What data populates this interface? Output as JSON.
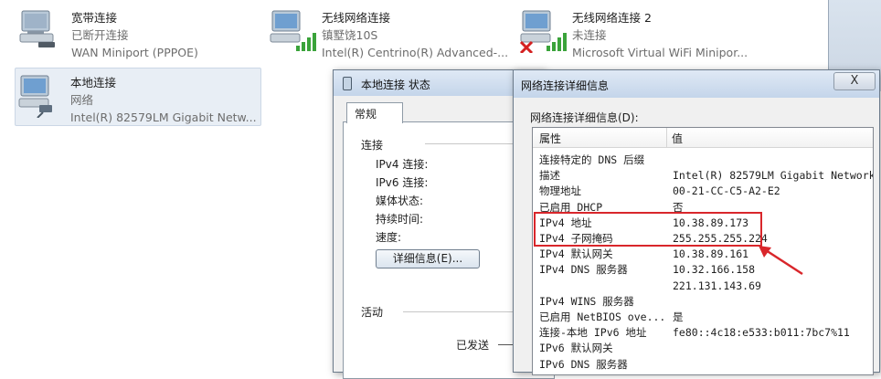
{
  "connections": [
    {
      "name": "宽带连接",
      "status": "已断开连接",
      "device": "WAN Miniport (PPPOE)"
    },
    {
      "name": "无线网络连接",
      "status": "镇墅饶10S",
      "device": "Intel(R) Centrino(R) Advanced-..."
    },
    {
      "name": "无线网络连接 2",
      "status": "未连接",
      "device": "Microsoft Virtual WiFi Minipor..."
    },
    {
      "name": "本地连接",
      "status": "网络",
      "device": "Intel(R) 82579LM Gigabit Netw..."
    }
  ],
  "status_window": {
    "title": "本地连接 状态",
    "tab": "常规",
    "connection_section": "连接",
    "labels": [
      "IPv4 连接:",
      "IPv6 连接:",
      "媒体状态:",
      "持续时间:",
      "速度:"
    ],
    "details_button": "详细信息(E)...",
    "activity_section": "活动",
    "sent_label": "已发送"
  },
  "details_window": {
    "title": "网络连接详细信息",
    "close": "X",
    "caption": "网络连接详细信息(D):",
    "col_property": "属性",
    "col_value": "值",
    "rows": [
      {
        "p": "连接特定的 DNS 后缀",
        "v": ""
      },
      {
        "p": "描述",
        "v": "Intel(R) 82579LM Gigabit Network"
      },
      {
        "p": "物理地址",
        "v": "00-21-CC-C5-A2-E2"
      },
      {
        "p": "已启用 DHCP",
        "v": "否"
      },
      {
        "p": "IPv4 地址",
        "v": "10.38.89.173"
      },
      {
        "p": "IPv4 子网掩码",
        "v": "255.255.255.224"
      },
      {
        "p": "IPv4 默认网关",
        "v": "10.38.89.161"
      },
      {
        "p": "IPv4 DNS 服务器",
        "v": "10.32.166.158"
      },
      {
        "p": "",
        "v": "221.131.143.69"
      },
      {
        "p": "IPv4 WINS 服务器",
        "v": ""
      },
      {
        "p": "已启用 NetBIOS ove...",
        "v": "是"
      },
      {
        "p": "连接-本地 IPv6 地址",
        "v": "fe80::4c18:e533:b011:7bc7%11"
      },
      {
        "p": "IPv6 默认网关",
        "v": ""
      },
      {
        "p": "IPv6 DNS 服务器",
        "v": ""
      }
    ]
  },
  "colors": {
    "highlight": "#d9262b",
    "selection": "#e8eef5",
    "dialog_bg": "#f0f0f0"
  }
}
